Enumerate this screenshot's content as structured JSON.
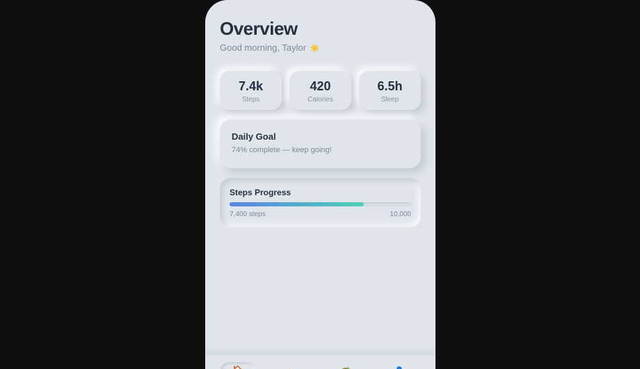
{
  "header": {
    "title": "Overview",
    "greeting": "Good morning, Taylor",
    "greeting_emoji": "☀️"
  },
  "stats": [
    {
      "value": "7.4k",
      "label": "Steps"
    },
    {
      "value": "420",
      "label": "Calories"
    },
    {
      "value": "6.5h",
      "label": "Sleep"
    }
  ],
  "goal": {
    "title": "Daily Goal",
    "subtitle": "74% complete — keep going!"
  },
  "steps_progress": {
    "title": "Steps Progress",
    "current_label": "7,400 steps",
    "target_label": "10,000",
    "fraction": 0.74,
    "fill_gradient": [
      "#5b83e6",
      "#4ed1b5"
    ]
  },
  "nav": {
    "items": [
      {
        "icon": "home-icon",
        "glyph": "🏠",
        "active": true
      },
      {
        "icon": "bolt-icon",
        "glyph": "⚡",
        "active": false
      },
      {
        "icon": "leaf-icon",
        "glyph": "🥗",
        "active": false
      },
      {
        "icon": "user-icon",
        "glyph": "👤",
        "active": false
      }
    ]
  },
  "colors": {
    "background": "#0f0f12",
    "surface": "#e0e5ec",
    "text_primary": "#27303f",
    "text_secondary": "#7d8897"
  }
}
